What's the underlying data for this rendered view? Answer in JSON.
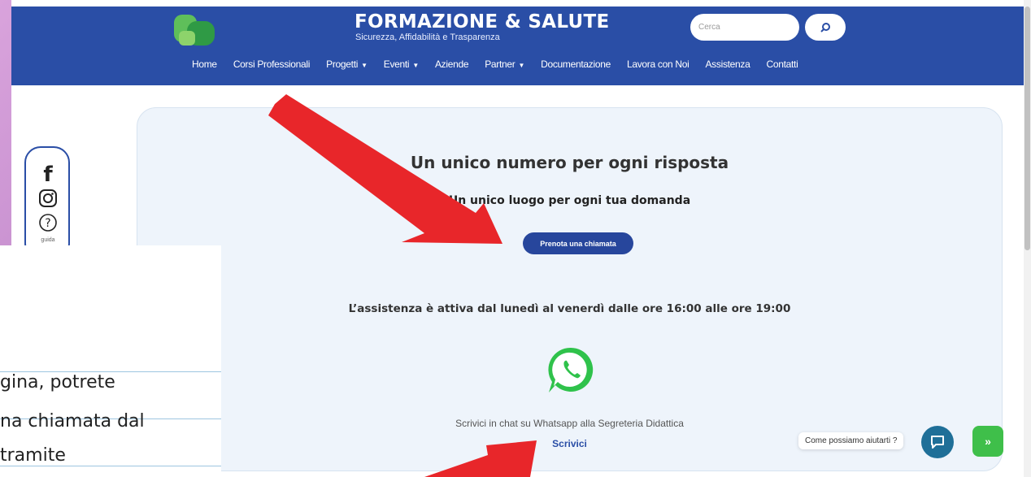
{
  "header": {
    "brand": "FORMAZIONE & SALUTE",
    "tagline": "Sicurezza, Affidabilità e Trasparenza",
    "search_placeholder": "Cerca",
    "nav": [
      {
        "label": "Home",
        "dropdown": false
      },
      {
        "label": "Corsi Professionali",
        "dropdown": false
      },
      {
        "label": "Progetti",
        "dropdown": true
      },
      {
        "label": "Eventi",
        "dropdown": true
      },
      {
        "label": "Aziende",
        "dropdown": false
      },
      {
        "label": "Partner",
        "dropdown": true
      },
      {
        "label": "Documentazione",
        "dropdown": false
      },
      {
        "label": "Lavora con Noi",
        "dropdown": false
      },
      {
        "label": "Assistenza",
        "dropdown": false
      },
      {
        "label": "Contatti",
        "dropdown": false
      }
    ]
  },
  "social": {
    "guide_label": "guida",
    "icons": [
      "facebook-icon",
      "instagram-icon",
      "help-icon"
    ]
  },
  "main": {
    "title": "Un unico numero per ogni risposta",
    "subtitle": "Un unico luogo per ogni tua domanda",
    "book_button": "Prenota una chiamata",
    "hours": "L’assistenza è attiva dal lunedì al venerdì dalle ore 16:00 alle ore 19:00",
    "whatsapp_text": "Scrivici in chat su Whatsapp alla Segreteria Didattica",
    "whatsapp_link": "Scrivici"
  },
  "chat": {
    "label": "Come possiamo aiutarti ?"
  },
  "overlay": {
    "lines": [
      "gina, potrete",
      "na chiamata dal",
      " tramite"
    ]
  },
  "colors": {
    "header": "#2a4ea6",
    "accent_green": "#3fbf4a",
    "arrow_red": "#e8262a"
  }
}
